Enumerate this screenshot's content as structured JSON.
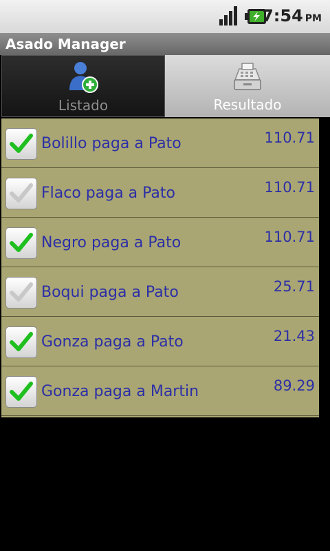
{
  "status_bar": {
    "time": "7:54",
    "ampm": "PM",
    "icons": [
      "signal-icon",
      "battery-charging-icon"
    ]
  },
  "app": {
    "title": "Asado Manager"
  },
  "tabs": [
    {
      "label": "Listado",
      "icon": "add-user-icon",
      "selected": false
    },
    {
      "label": "Resultado",
      "icon": "cash-register-icon",
      "selected": true
    }
  ],
  "payments": [
    {
      "label": "Bolillo paga a Pato",
      "amount": "110.71",
      "checked": true
    },
    {
      "label": "Flaco paga a Pato",
      "amount": "110.71",
      "checked": false
    },
    {
      "label": "Negro paga a Pato",
      "amount": "110.71",
      "checked": true
    },
    {
      "label": "Boqui paga a Pato",
      "amount": "25.71",
      "checked": false
    },
    {
      "label": "Gonza paga a Pato",
      "amount": "21.43",
      "checked": true
    },
    {
      "label": "Gonza paga a Martin",
      "amount": "89.29",
      "checked": true
    }
  ],
  "colors": {
    "list_background": "#a9a673",
    "text": "#2c2fa6",
    "check_on": "#1fbf1f",
    "check_off": "#c8c8c8"
  }
}
